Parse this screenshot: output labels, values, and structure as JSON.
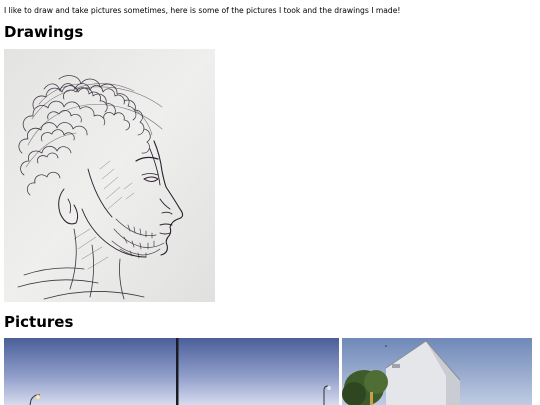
{
  "intro": {
    "text": "I like to draw and take pictures sometimes, here is some of the pictures I took and the drawings I made!"
  },
  "sections": {
    "drawings": {
      "heading": "Drawings"
    },
    "pictures": {
      "heading": "Pictures"
    }
  },
  "images": {
    "drawing_1": {
      "subject": "pen sketch of a man's head in profile with curly hair and beard"
    },
    "photo_1": {
      "subject": "street at dusk with lamp posts"
    },
    "photo_2": {
      "subject": "white gabled house with tree"
    }
  },
  "colors": {
    "page_background": "#ffffff",
    "text": "#000000",
    "sketch_paper": "#ebebe9",
    "sketch_ink": "#2a2030",
    "sky_top": "#4a5f99",
    "sky_bottom": "#d6dbee"
  }
}
